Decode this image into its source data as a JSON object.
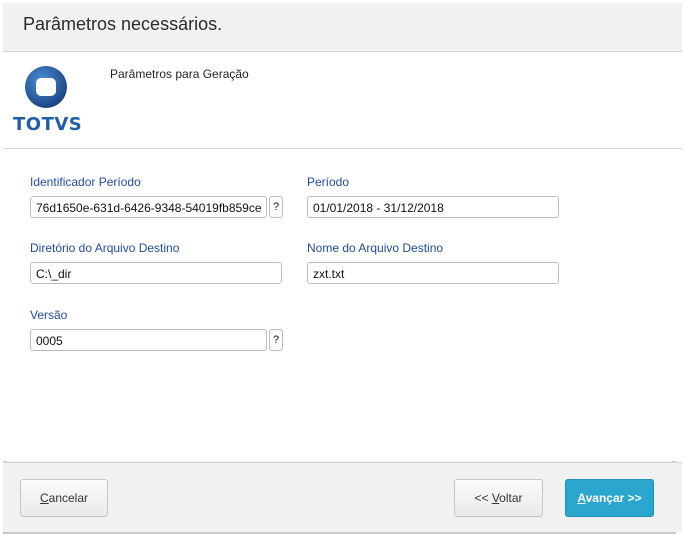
{
  "window": {
    "title": "Parâmetros necessários."
  },
  "header": {
    "logo_text": "TOTVS",
    "subtitle": "Parâmetros para Geração"
  },
  "form": {
    "identificador": {
      "label": "Identificador Período",
      "value": "76d1650e-631d-6426-9348-54019fb859ce",
      "help": "?"
    },
    "periodo": {
      "label": "Período",
      "value": "01/01/2018 - 31/12/2018"
    },
    "diretorio": {
      "label": "Diretório do Arquivo Destino",
      "value": "C:\\_dir"
    },
    "nome_arquivo": {
      "label": "Nome do Arquivo Destino",
      "value": "zxt.txt"
    },
    "versao": {
      "label": "Versão",
      "value": "0005",
      "help": "?"
    }
  },
  "footer": {
    "cancel": {
      "prefix": "",
      "accel": "C",
      "rest": "ancelar"
    },
    "back": {
      "prefix": "<< ",
      "accel": "V",
      "rest": "oltar"
    },
    "next": {
      "prefix": "",
      "accel": "A",
      "rest": "vançar >>"
    }
  },
  "colors": {
    "label_blue": "#1f4d9b",
    "primary_button": "#2aa6cf",
    "logo_blue": "#1e5fa8"
  }
}
